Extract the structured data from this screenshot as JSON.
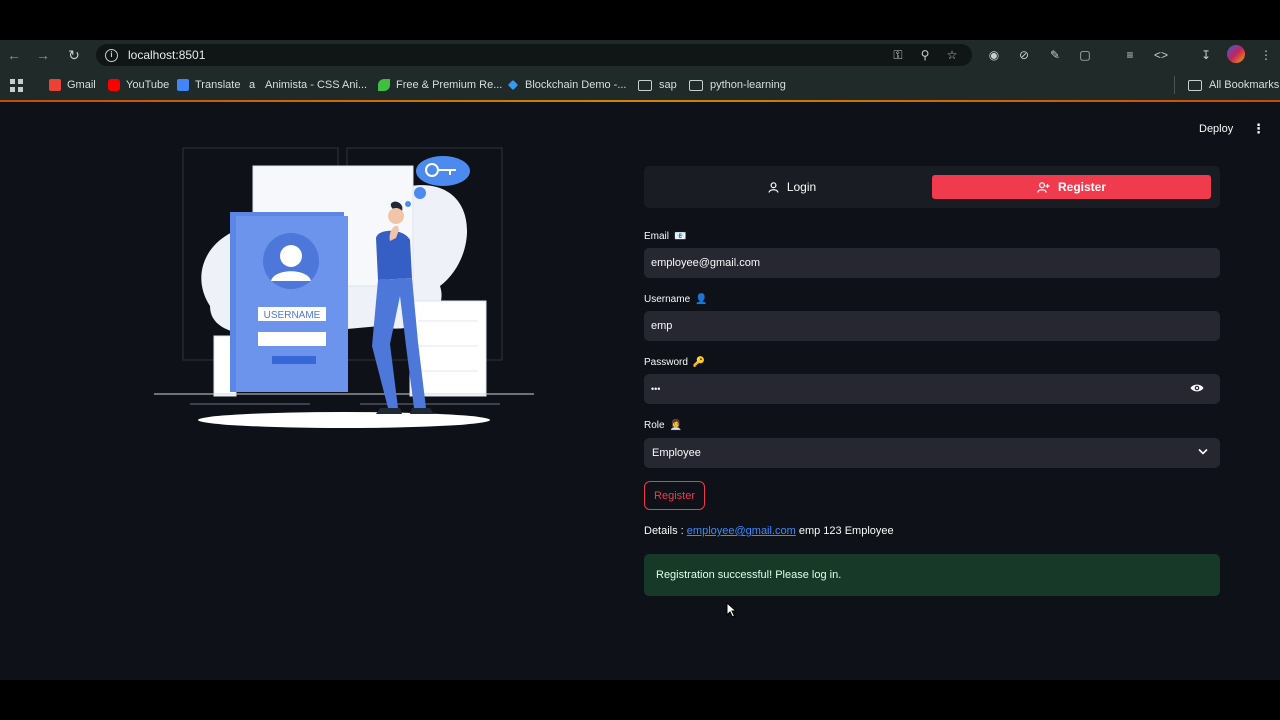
{
  "browser": {
    "url": "localhost:8501",
    "bookmarks": [
      {
        "label": "Gmail",
        "icon": "gmail-icon",
        "color": "#ea4335"
      },
      {
        "label": "YouTube",
        "icon": "youtube-icon",
        "color": "#ff0000"
      },
      {
        "label": "Translate",
        "icon": "translate-icon",
        "color": "#4285f4"
      },
      {
        "label": "Animista - CSS Ani...",
        "icon": "animista-icon",
        "color": "#1f2a29"
      },
      {
        "label": "Free & Premium Re...",
        "icon": "leaf-icon",
        "color": "#3fbf3f"
      },
      {
        "label": "Blockchain Demo -...",
        "icon": "blockchain-icon",
        "color": "#339af0"
      },
      {
        "label": "sap",
        "icon": "folder-icon"
      },
      {
        "label": "python-learning",
        "icon": "folder-icon"
      }
    ],
    "all_bookmarks": "All Bookmarks"
  },
  "app": {
    "deploy_label": "Deploy",
    "tabs": {
      "login": "Login",
      "register": "Register"
    },
    "illustration": {
      "card_text": "USERNAME"
    },
    "form": {
      "email": {
        "label": "Email",
        "emoji": "📧",
        "value": "employee@gmail.com"
      },
      "username": {
        "label": "Username",
        "emoji": "👤",
        "value": "emp"
      },
      "password": {
        "label": "Password",
        "emoji": "🔑",
        "masked_value": "•••"
      },
      "role": {
        "label": "Role",
        "emoji": "👩‍💼",
        "value": "Employee"
      },
      "submit_label": "Register"
    },
    "details": {
      "prefix": "Details : ",
      "email_link": "employee@gmail.com",
      "suffix": " emp 123 Employee"
    },
    "success_message": "Registration successful! Please log in."
  },
  "colors": {
    "primary": "#ef3b4d",
    "app_background": "#0e1117",
    "input_background": "#262730",
    "success_background": "#173928",
    "link": "#3d8bfd"
  }
}
